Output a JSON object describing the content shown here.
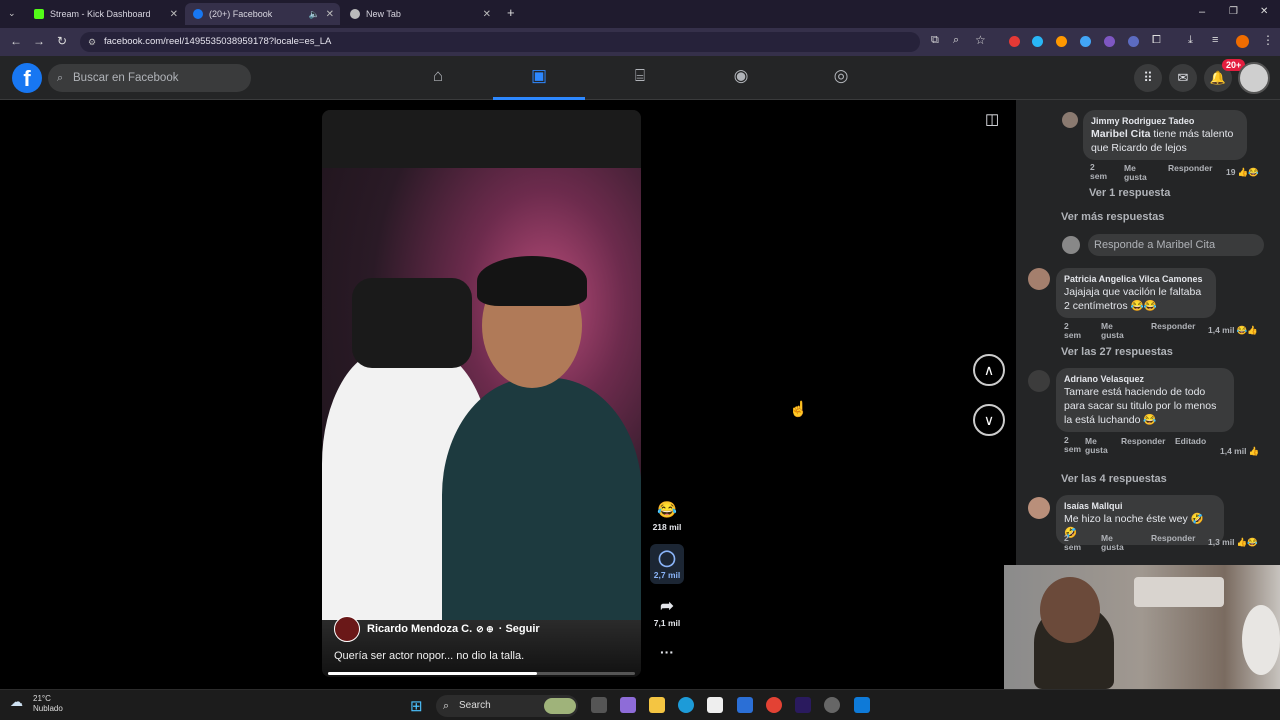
{
  "browser": {
    "tabs": [
      {
        "title": "Stream - Kick Dashboard",
        "active": false
      },
      {
        "title": "(20+) Facebook",
        "active": true
      },
      {
        "title": "New Tab",
        "active": false
      }
    ],
    "url": "facebook.com/reel/1495535038959178?locale=es_LA"
  },
  "facebook": {
    "search_placeholder": "Buscar en Facebook",
    "nav": [
      "home-icon",
      "reels-icon",
      "marketplace-icon",
      "groups-icon",
      "gaming-icon"
    ],
    "notification_badge": "20+"
  },
  "reel": {
    "author": "Ricardo Mendoza C.",
    "follow": "· Seguir",
    "caption": "Quería ser actor nopor... no dio la talla.",
    "progress": 0.68,
    "reactions": "218 mil",
    "comments": "2,7 mil",
    "shares": "7,1 mil"
  },
  "comments": {
    "c1": {
      "name": "Jimmy Rodriguez Tadeo",
      "mention": "Maribel Cita",
      "text": " tiene más talento que Ricardo de lejos",
      "time": "2 sem",
      "count": "19"
    },
    "c1_replies": "Ver 1 respuesta",
    "more": "Ver más respuestas",
    "reply_placeholder": "Responde a Maribel Cita",
    "c2": {
      "name": "Patricia Angelica Vilca Camones",
      "text": "Jajajaja que vacilón le faltaba 2 centímetros 😂😂",
      "time": "2 sem",
      "count": "1,4 mil",
      "replies": "Ver las 27 respuestas"
    },
    "c3": {
      "name": "Adriano Velasquez",
      "text": "Tamare está haciendo de todo para sacar su titulo por lo menos la está luchando 😂",
      "time": "2 sem",
      "edited": "Editado",
      "count": "1,4 mil",
      "replies": "Ver las 4 respuestas"
    },
    "c4": {
      "name": "Isaías Mallqui",
      "text": "Me hizo la noche éste wey 🤣🤣",
      "time": "2 sem",
      "count": "1,3 mil"
    },
    "like": "Me gusta",
    "reply": "Responder"
  },
  "taskbar": {
    "temp": "21°C",
    "weather": "Nublado",
    "search": "Search"
  }
}
